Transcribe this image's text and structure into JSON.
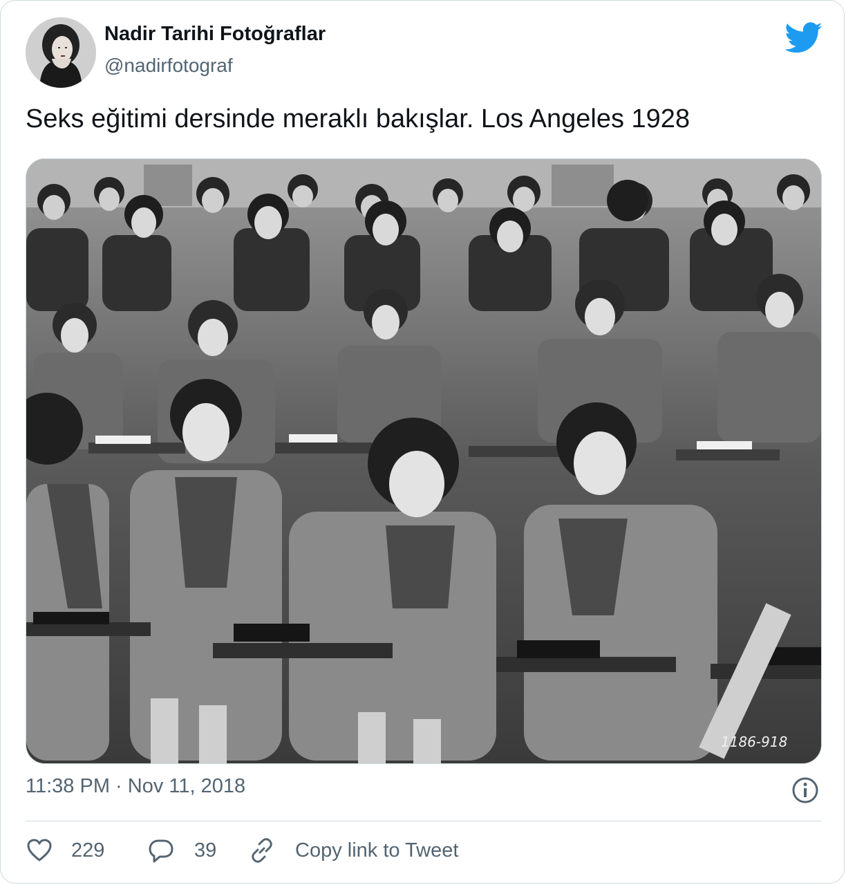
{
  "author": {
    "name": "Nadir Tarihi Fotoğraflar",
    "handle": "@nadirfotograf",
    "avatar_icon": "avatar-portrait-icon"
  },
  "tweet": {
    "text": "Seks eğitimi dersinde meraklı bakışlar. Los Angeles 1928",
    "timestamp": "11:38 PM · Nov 11, 2018",
    "photo_caption_mark": "1186-918"
  },
  "actions": {
    "likes": "229",
    "replies": "39",
    "copy_link_label": "Copy link to Tweet"
  },
  "icons": {
    "brand": "twitter-bird-icon",
    "info": "info-icon",
    "like": "heart-icon",
    "reply": "reply-bubble-icon",
    "copy": "link-icon"
  },
  "colors": {
    "twitter_blue": "#1d9bf0",
    "text_primary": "#0f1419",
    "text_secondary": "#536471",
    "border": "#cfd9de"
  }
}
